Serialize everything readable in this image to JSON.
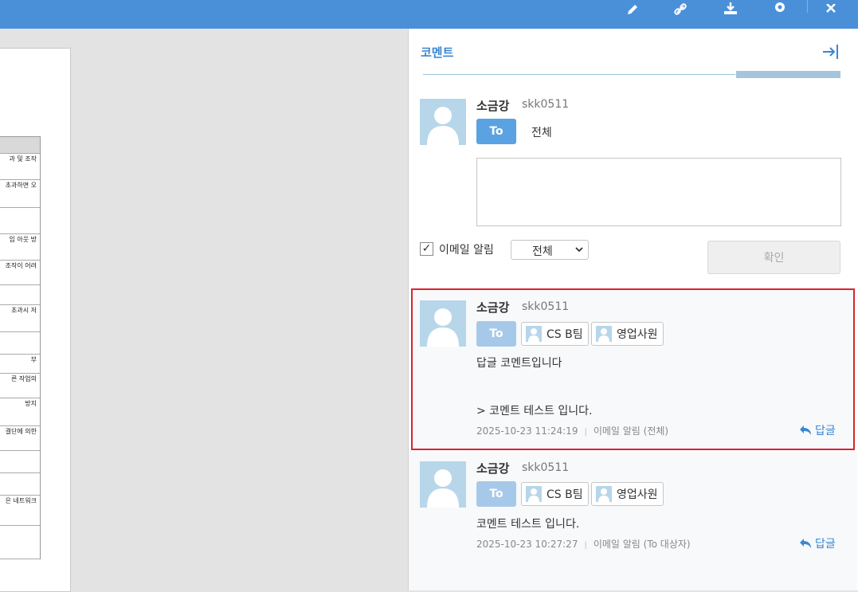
{
  "toolbar": {
    "icons": [
      "pencil-icon",
      "link-icon",
      "download-icon",
      "settings-icon",
      "close-icon"
    ]
  },
  "document": {
    "rows": [
      "",
      "과 및 조작",
      "초과하면 오",
      "",
      "임 아웃 방",
      "조작이 어려",
      "",
      "초과시 저",
      "",
      "부",
      "른 작업의",
      "방지",
      "결단에 의한",
      "",
      "",
      "은 네트워크",
      ""
    ]
  },
  "panel": {
    "title": "코멘트",
    "composer": {
      "author": "소금강",
      "user_id": "skk0511",
      "to_label": "To",
      "to_target": "전체",
      "textarea_placeholder": "",
      "email_label": "이메일 알림",
      "email_checked": "✓",
      "select_value": "전체",
      "confirm_label": "확인"
    },
    "comments": [
      {
        "author": "소금강",
        "user_id": "skk0511",
        "to_label": "To",
        "recipients": [
          "CS B팀",
          "영업사원"
        ],
        "line1": "답글 코멘트입니다",
        "line2": "> 코멘트 테스트 입니다.",
        "timestamp": "2025-10-23 11:24:19",
        "email_info": "이메일 알림 (전체)",
        "reply_label": "답글"
      },
      {
        "author": "소금강",
        "user_id": "skk0511",
        "to_label": "To",
        "recipients": [
          "CS B팀",
          "영업사원"
        ],
        "line1": "코멘트 테스트 입니다.",
        "timestamp": "2025-10-23 10:27:27",
        "email_info": "이메일 알림 (To 대상자)",
        "reply_label": "답글"
      }
    ]
  }
}
